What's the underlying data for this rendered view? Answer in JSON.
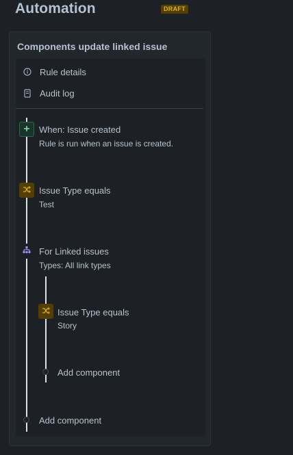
{
  "header": {
    "title": "Automation",
    "status_badge": "DRAFT"
  },
  "panel": {
    "title": "Components update linked issue",
    "menu": [
      {
        "label": "Rule details",
        "icon": "info-icon"
      },
      {
        "label": "Audit log",
        "icon": "document-icon"
      }
    ]
  },
  "flow": {
    "trigger": {
      "title": "When: Issue created",
      "subtitle": "Rule is run when an issue is created.",
      "icon": "plus-icon"
    },
    "condition": {
      "title": "Issue Type equals",
      "subtitle": "Test",
      "icon": "shuffle-icon"
    },
    "branch": {
      "title": "For Linked issues",
      "subtitle": "Types: All link types",
      "icon": "branch-icon",
      "children": {
        "condition": {
          "title": "Issue Type equals",
          "subtitle": "Story",
          "icon": "shuffle-icon"
        },
        "add_label": "Add component"
      }
    },
    "add_label": "Add component"
  },
  "colors": {
    "background": "#1d2125",
    "panel": "#22272b",
    "badge_bg": "#533f04",
    "badge_text": "#e2b203",
    "trigger_green": "#216e4e",
    "condition_yellow": "#533f04",
    "branch_purple": "#9f8fef"
  }
}
